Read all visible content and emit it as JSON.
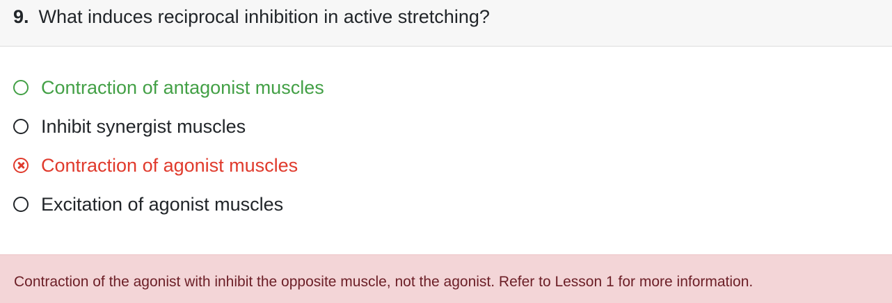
{
  "question": {
    "number": "9.",
    "text": "What induces reciprocal inhibition in active stretching?"
  },
  "options": [
    {
      "label": "Contraction of antagonist muscles",
      "state": "correct"
    },
    {
      "label": "Inhibit synergist muscles",
      "state": "neutral"
    },
    {
      "label": "Contraction of agonist muscles",
      "state": "wrong"
    },
    {
      "label": "Excitation of agonist muscles",
      "state": "neutral"
    }
  ],
  "feedback": {
    "text": "Contraction of the agonist with inhibit the opposite muscle, not the agonist. Refer to Lesson 1 for more information."
  },
  "colors": {
    "correct": "#43a046",
    "wrong": "#e03a2c",
    "feedback_bg": "#f3d5d7",
    "feedback_text": "#6b1e26"
  }
}
